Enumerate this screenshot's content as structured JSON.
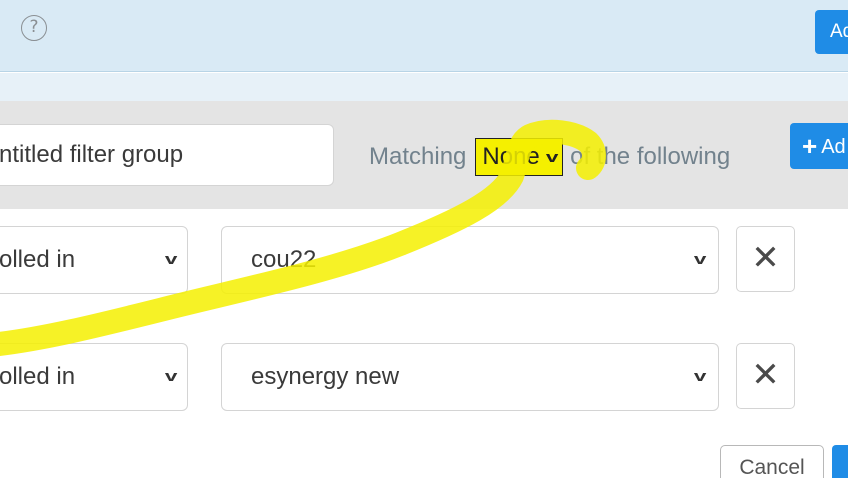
{
  "topbar": {
    "help_icon": "?",
    "top_button_label": "Ad"
  },
  "filter_group": {
    "name_value": "ntitled filter group",
    "matching_prefix": "Matching",
    "matching_value": "None",
    "matching_suffix": "of the following",
    "add_button_label": "Ad",
    "add_button_icon": "plus-icon"
  },
  "rules": [
    {
      "field": "olled in",
      "value": "cou22",
      "remove_icon": "close-icon"
    },
    {
      "field": "olled in",
      "value": "esynergy new",
      "remove_icon": "close-icon"
    }
  ],
  "footer": {
    "cancel_label": "Cancel"
  },
  "colors": {
    "accent": "#1f8ce6",
    "topbar_bg": "#d9eaf5",
    "group_header_bg": "#e4e4e4",
    "highlight": "#f5f000"
  }
}
